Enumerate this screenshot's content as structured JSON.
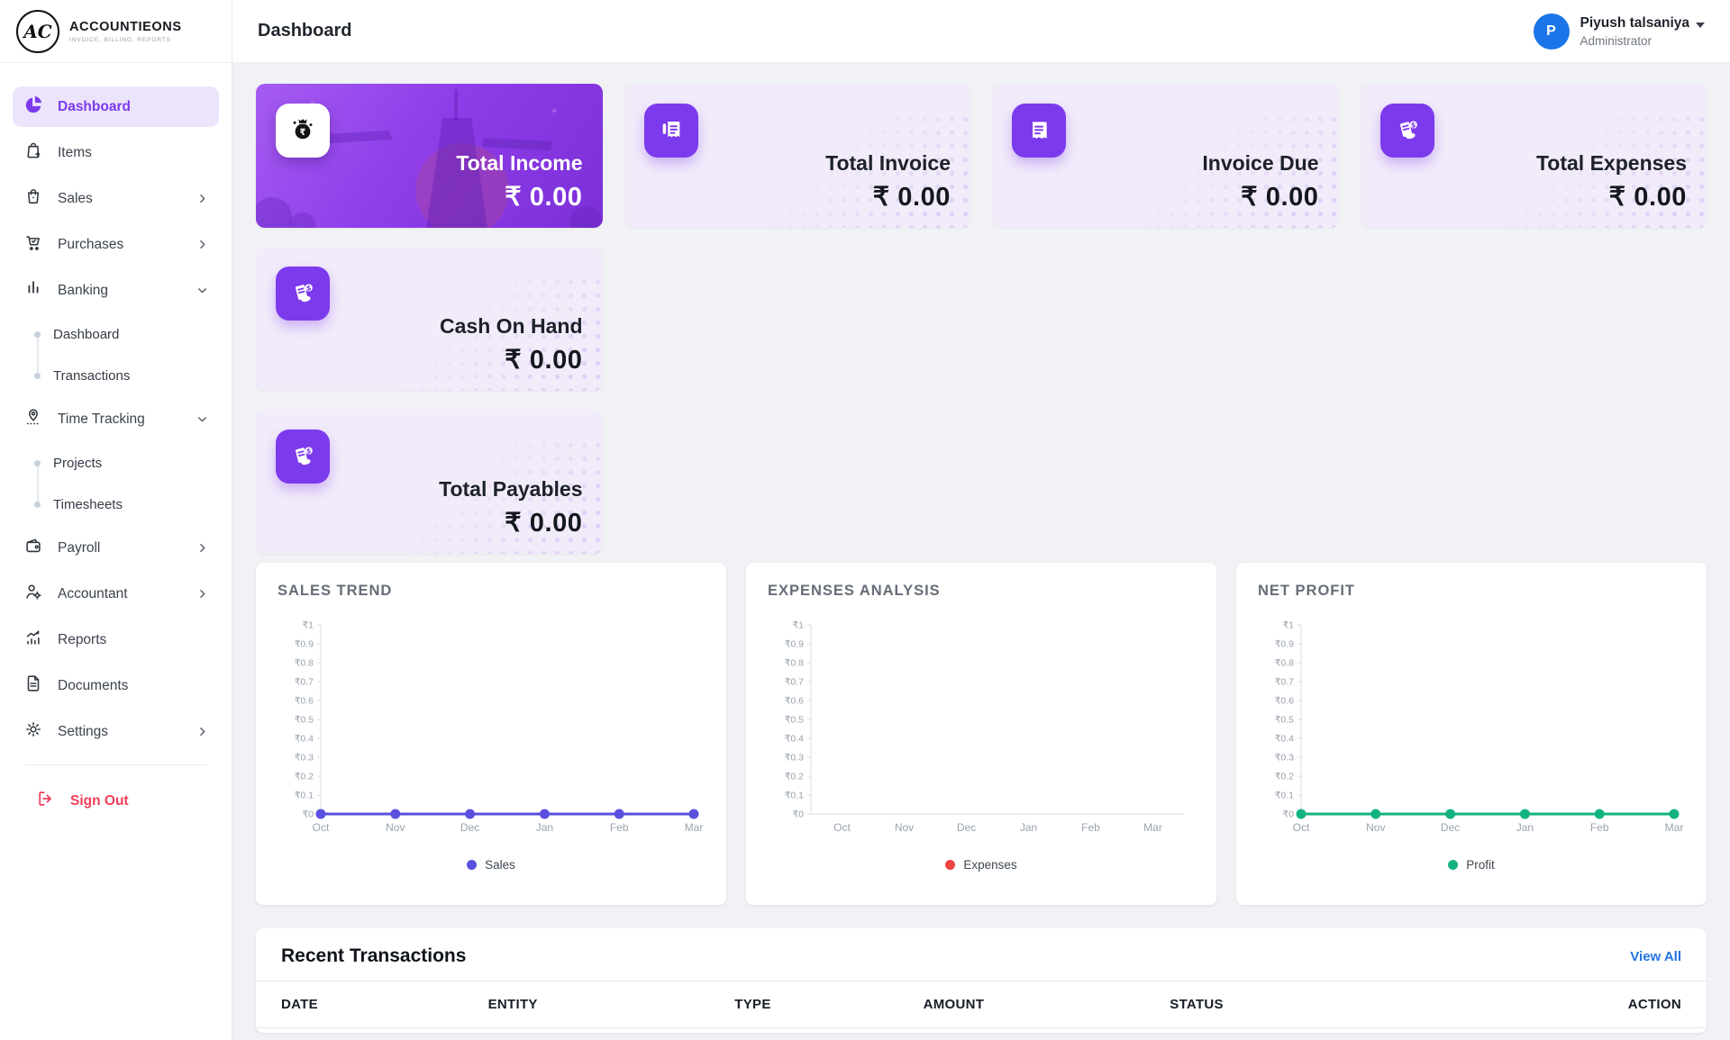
{
  "brand": {
    "monogram": "AC",
    "name": "ACCOUNTIEONS",
    "tagline": "INVOICE, BILLING, REPORTS"
  },
  "header": {
    "title": "Dashboard"
  },
  "user": {
    "initial": "P",
    "name": "Piyush talsaniya",
    "role": "Administrator"
  },
  "sidebar": {
    "items": [
      {
        "label": "Dashboard",
        "active": true
      },
      {
        "label": "Items"
      },
      {
        "label": "Sales"
      },
      {
        "label": "Purchases"
      },
      {
        "label": "Banking",
        "children": [
          {
            "label": "Dashboard"
          },
          {
            "label": "Transactions"
          }
        ]
      },
      {
        "label": "Time Tracking",
        "children": [
          {
            "label": "Projects"
          },
          {
            "label": "Timesheets"
          }
        ]
      },
      {
        "label": "Payroll"
      },
      {
        "label": "Accountant"
      },
      {
        "label": "Reports"
      },
      {
        "label": "Documents"
      },
      {
        "label": "Settings"
      }
    ],
    "sign_out": "Sign Out"
  },
  "stats": [
    {
      "label": "Total Income",
      "value": "₹ 0.00"
    },
    {
      "label": "Total Invoice",
      "value": "₹ 0.00"
    },
    {
      "label": "Invoice Due",
      "value": "₹ 0.00"
    },
    {
      "label": "Total Expenses",
      "value": "₹ 0.00"
    },
    {
      "label": "Cash On Hand",
      "value": "₹ 0.00"
    },
    {
      "label": "Total Payables",
      "value": "₹ 0.00"
    }
  ],
  "chart_data": [
    {
      "type": "line",
      "title": "SALES TREND",
      "x": [
        "Oct",
        "Nov",
        "Dec",
        "Jan",
        "Feb",
        "Mar"
      ],
      "x_align": "point",
      "ylim": [
        0,
        1
      ],
      "yticks": [
        "₹1",
        "₹0.9",
        "₹0.8",
        "₹0.7",
        "₹0.6",
        "₹0.5",
        "₹0.4",
        "₹0.3",
        "₹0.2",
        "₹0.1",
        "₹0"
      ],
      "grid": false,
      "legend_position": "bottom",
      "series": [
        {
          "name": "Sales",
          "color": "#5a4fdf",
          "values": [
            0,
            0,
            0,
            0,
            0,
            0
          ]
        }
      ]
    },
    {
      "type": "line",
      "title": "EXPENSES ANALYSIS",
      "x": [
        "Oct",
        "Nov",
        "Dec",
        "Jan",
        "Feb",
        "Mar"
      ],
      "x_align": "band",
      "ylim": [
        0,
        1
      ],
      "yticks": [
        "₹1",
        "₹0.9",
        "₹0.8",
        "₹0.7",
        "₹0.6",
        "₹0.5",
        "₹0.4",
        "₹0.3",
        "₹0.2",
        "₹0.1",
        "₹0"
      ],
      "grid": false,
      "legend_position": "bottom",
      "series": [
        {
          "name": "Expenses",
          "color": "#ef4444",
          "values": []
        }
      ]
    },
    {
      "type": "line",
      "title": "NET PROFIT",
      "x": [
        "Oct",
        "Nov",
        "Dec",
        "Jan",
        "Feb",
        "Mar"
      ],
      "x_align": "point",
      "ylim": [
        0,
        1
      ],
      "yticks": [
        "₹1",
        "₹0.9",
        "₹0.8",
        "₹0.7",
        "₹0.6",
        "₹0.5",
        "₹0.4",
        "₹0.3",
        "₹0.2",
        "₹0.1",
        "₹0"
      ],
      "grid": false,
      "legend_position": "bottom",
      "series": [
        {
          "name": "Profit",
          "color": "#12b381",
          "values": [
            0,
            0,
            0,
            0,
            0,
            0
          ]
        }
      ]
    }
  ],
  "transactions": {
    "title": "Recent Transactions",
    "view_all": "View All",
    "columns": [
      "DATE",
      "ENTITY",
      "TYPE",
      "AMOUNT",
      "STATUS",
      "ACTION"
    ],
    "rows": []
  },
  "colors": {
    "accent": "#7c3aed",
    "avatar": "#1b74e8",
    "link": "#2273e3",
    "sign_out": "#ee3e5a",
    "sales_line": "#5a4fdf",
    "expenses_line": "#ef4444",
    "profit_line": "#12b381"
  }
}
